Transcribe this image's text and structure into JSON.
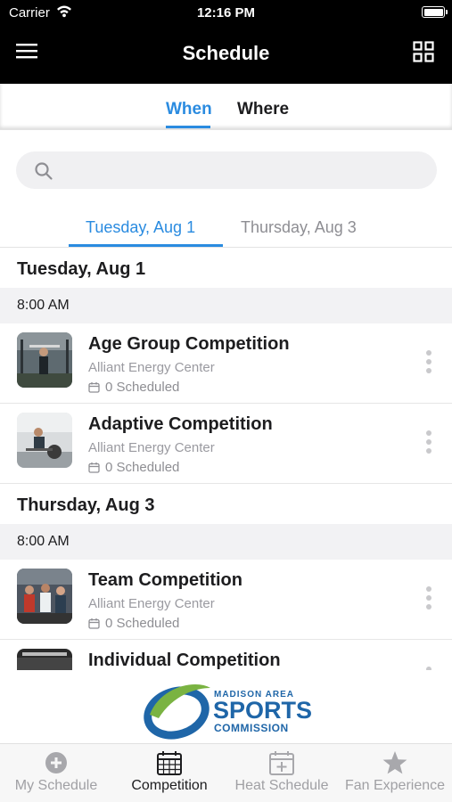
{
  "status": {
    "carrier": "Carrier",
    "time": "12:16 PM"
  },
  "nav": {
    "title": "Schedule",
    "menu_icon": "hamburger-menu-icon",
    "grid_icon": "grid-icon"
  },
  "switcher": {
    "options": [
      "When",
      "Where"
    ],
    "selected": "When"
  },
  "search": {
    "placeholder": "",
    "value": ""
  },
  "date_tabs": [
    {
      "label": "Tuesday, Aug 1",
      "selected": true
    },
    {
      "label": "Thursday, Aug 3",
      "selected": false
    }
  ],
  "days": [
    {
      "heading": "Tuesday, Aug 1",
      "time": "8:00 AM",
      "events": [
        {
          "name": "Age Group Competition",
          "venue": "Alliant Energy Center",
          "scheduled": "0 Scheduled"
        },
        {
          "name": "Adaptive Competition",
          "venue": "Alliant Energy Center",
          "scheduled": "0 Scheduled"
        }
      ]
    },
    {
      "heading": "Thursday, Aug 3",
      "time": "8:00 AM",
      "events": [
        {
          "name": "Team Competition",
          "venue": "Alliant Energy Center",
          "scheduled": "0 Scheduled"
        },
        {
          "name": "Individual Competition",
          "venue": "",
          "scheduled": ""
        }
      ]
    }
  ],
  "sponsor": {
    "line1": "MADISON AREA",
    "line2": "SPORTS",
    "line3": "COMMISSION"
  },
  "tabs": [
    {
      "label": "My Schedule",
      "icon": "plus-circle-icon",
      "active": false
    },
    {
      "label": "Competition",
      "icon": "calendar-icon",
      "active": true
    },
    {
      "label": "Heat Schedule",
      "icon": "calendar-plus-icon",
      "active": false
    },
    {
      "label": "Fan Experience",
      "icon": "star-icon",
      "active": false
    }
  ],
  "colors": {
    "accent": "#2a8be0",
    "navbar": "#000000",
    "logo_green": "#7ab342",
    "logo_blue": "#1f66a8"
  }
}
